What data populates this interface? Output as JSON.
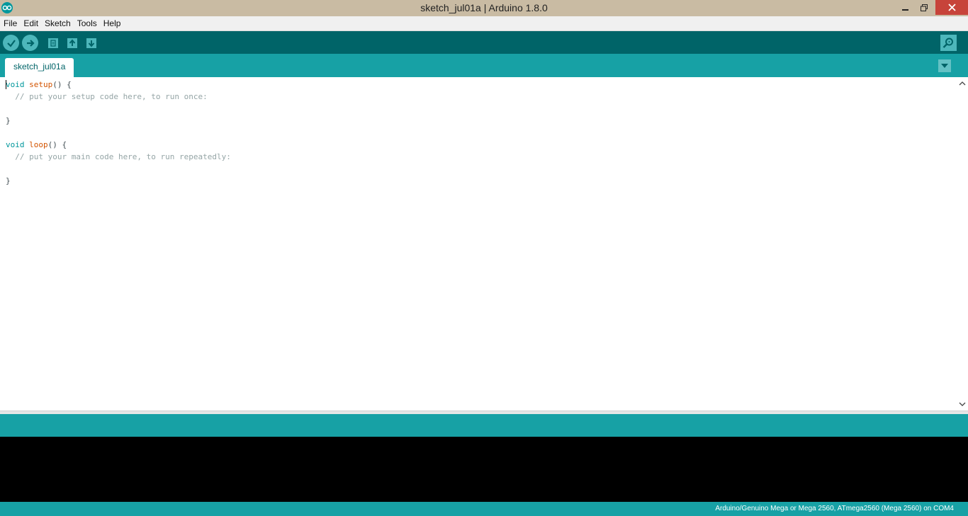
{
  "window": {
    "title": "sketch_jul01a | Arduino 1.8.0"
  },
  "menu": {
    "items": [
      "File",
      "Edit",
      "Sketch",
      "Tools",
      "Help"
    ]
  },
  "toolbar": {
    "buttons": [
      {
        "name": "verify",
        "icon": "checkmark-icon"
      },
      {
        "name": "upload",
        "icon": "arrow-right-icon"
      },
      {
        "name": "new",
        "icon": "document-icon"
      },
      {
        "name": "open",
        "icon": "arrow-up-icon"
      },
      {
        "name": "save",
        "icon": "arrow-down-icon"
      },
      {
        "name": "serial-monitor",
        "icon": "magnifier-icon"
      }
    ]
  },
  "tabs": {
    "active": "sketch_jul01a"
  },
  "editor": {
    "lines": [
      {
        "kw": "void",
        "fn": "setup",
        "rest": "() {"
      },
      {
        "comment": "  // put your setup code here, to run once:"
      },
      {
        "text": ""
      },
      {
        "text": "}"
      },
      {
        "text": ""
      },
      {
        "kw": "void",
        "fn": "loop",
        "rest": "() {"
      },
      {
        "comment": "  // put your main code here, to run repeatedly:"
      },
      {
        "text": ""
      },
      {
        "text": "}"
      }
    ]
  },
  "status": {
    "board": "Arduino/Genuino Mega or Mega 2560, ATmega2560 (Mega 2560) on COM4"
  },
  "colors": {
    "title_bg": "#c9bba3",
    "toolbar_bg": "#006468",
    "teal": "#17a1a5",
    "console_bg": "#000000",
    "close_btn": "#c7433a"
  }
}
